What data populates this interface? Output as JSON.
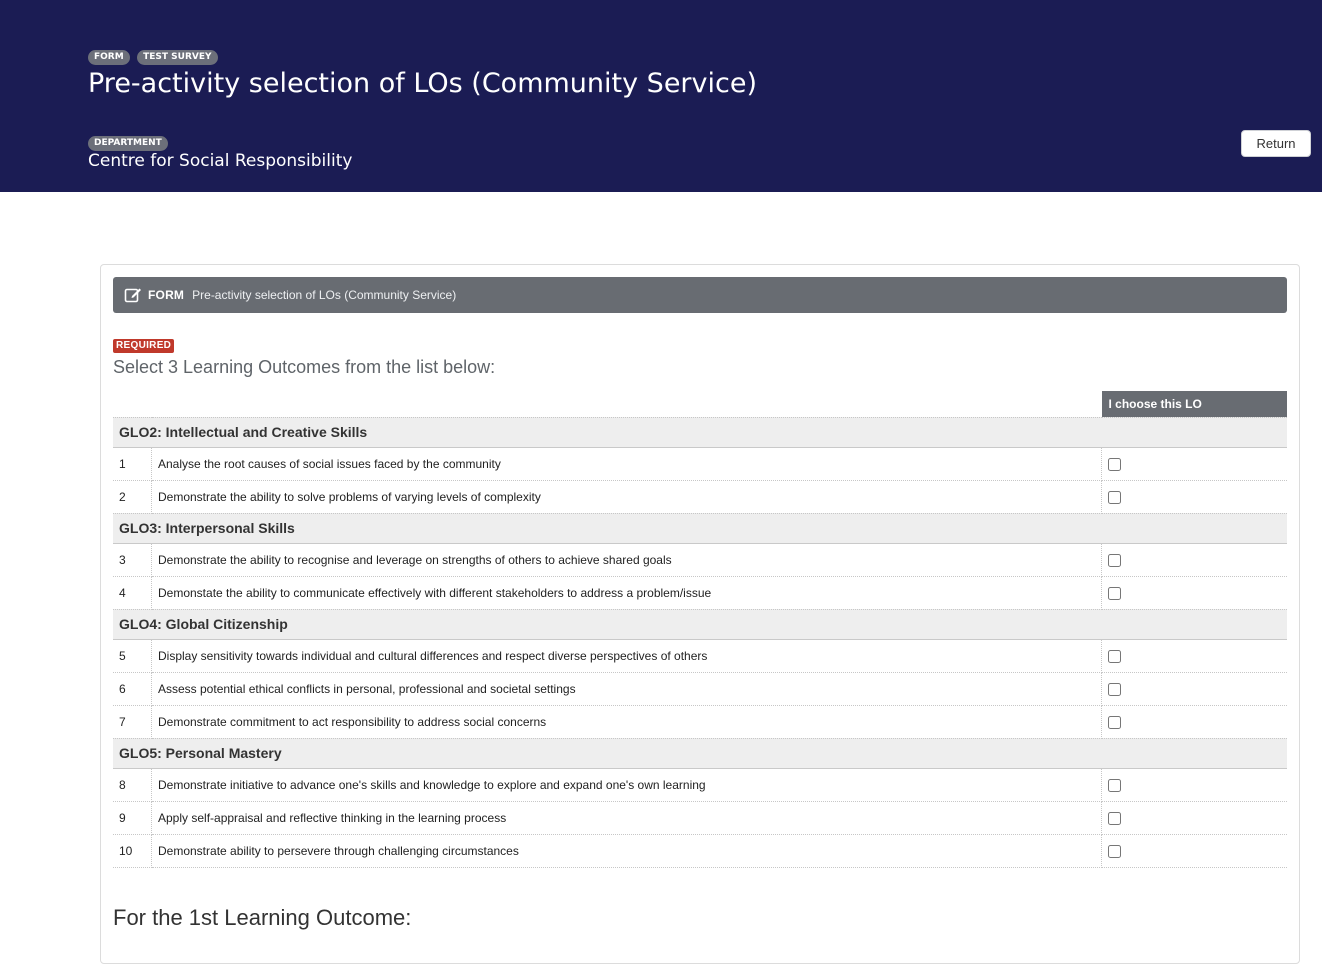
{
  "header": {
    "tags": [
      "FORM",
      "TEST SURVEY"
    ],
    "title": "Pre-activity selection of LOs (Community Service)",
    "department_tag": "DEPARTMENT",
    "department": "Centre for Social Responsibility",
    "return_label": "Return",
    "background_color": "#1b1c54"
  },
  "form_bar": {
    "icon": "edit-icon",
    "label": "FORM",
    "name": "Pre-activity selection of LOs (Community Service)"
  },
  "question": {
    "required_label": "REQUIRED",
    "text": "Select 3 Learning Outcomes from the list below:",
    "column_header": "I choose this LO",
    "required_color": "#c0392b",
    "groups": [
      {
        "title": "GLO2: Intellectual and Creative Skills",
        "items": [
          {
            "num": "1",
            "text": "Analyse the root causes of social issues faced by the community",
            "checked": false
          },
          {
            "num": "2",
            "text": "Demonstrate the ability to solve problems of varying levels of complexity",
            "checked": false
          }
        ]
      },
      {
        "title": "GLO3: Interpersonal Skills",
        "items": [
          {
            "num": "3",
            "text": "Demonstrate the ability to recognise and leverage on strengths of others to achieve shared goals",
            "checked": false
          },
          {
            "num": "4",
            "text": "Demonstate the ability to communicate effectively with different stakeholders to address a problem/issue",
            "checked": false
          }
        ]
      },
      {
        "title": "GLO4: Global Citizenship",
        "items": [
          {
            "num": "5",
            "text": "Display sensitivity towards individual and cultural differences and respect diverse perspectives of others",
            "checked": false
          },
          {
            "num": "6",
            "text": "Assess potential ethical conflicts in personal, professional and societal settings",
            "checked": false
          },
          {
            "num": "7",
            "text": "Demonstrate commitment to act responsibility to address social concerns",
            "checked": false
          }
        ]
      },
      {
        "title": "GLO5: Personal Mastery",
        "items": [
          {
            "num": "8",
            "text": "Demonstrate initiative to advance one's skills and knowledge to explore and expand one's own learning",
            "checked": false
          },
          {
            "num": "9",
            "text": "Apply self-appraisal and reflective thinking in the learning process",
            "checked": false
          },
          {
            "num": "10",
            "text": "Demonstrate ability to persevere through challenging circumstances",
            "checked": false
          }
        ]
      }
    ]
  },
  "next_question": "For the 1st Learning Outcome:"
}
